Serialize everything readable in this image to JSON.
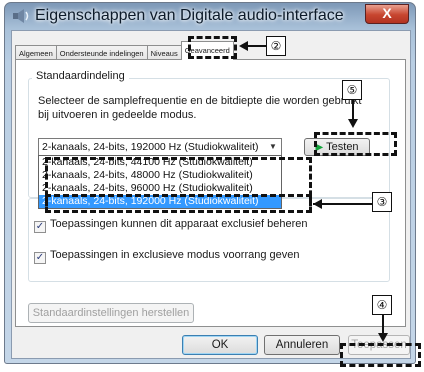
{
  "window": {
    "title": "Eigenschappen van Digitale audio-interface",
    "close_glyph": "X"
  },
  "tabs": [
    {
      "label": "Algemeen"
    },
    {
      "label": "Ondersteunde indelingen"
    },
    {
      "label": "Niveaus"
    },
    {
      "label": "Geavanceerd"
    }
  ],
  "default_format": {
    "group_label": "Standaardindeling",
    "description": "Selecteer de samplefrequentie en de bitdiepte die worden gebruikt bij uitvoeren in gedeelde modus.",
    "selected_value": "2-kanaals, 24-bits, 192000 Hz (Studiokwaliteit)",
    "options": [
      "2-kanaals, 24-bits, 44100 Hz (Studiokwaliteit)",
      "2-kanaals, 24-bits, 48000 Hz (Studiokwaliteit)",
      "2-kanaals, 24-bits, 96000 Hz (Studiokwaliteit)",
      "2-kanaals, 24-bits, 192000 Hz (Studiokwaliteit)"
    ],
    "test_label": "Testen"
  },
  "exclusive_mode": {
    "allow_exclusive": "Toepassingen kunnen dit apparaat exclusief beheren",
    "give_priority": "Toepassingen in exclusieve modus voorrang geven"
  },
  "buttons": {
    "restore_defaults": "Standaardinstellingen herstellen",
    "ok": "OK",
    "cancel": "Annuleren",
    "apply": "Toepassen"
  },
  "callouts": {
    "tab": "②",
    "dropdown": "③",
    "apply": "④",
    "test": "⑤"
  },
  "colors": {
    "selection": "#3399ff",
    "close_button": "#c7452f",
    "play_icon": "#13a33b"
  }
}
